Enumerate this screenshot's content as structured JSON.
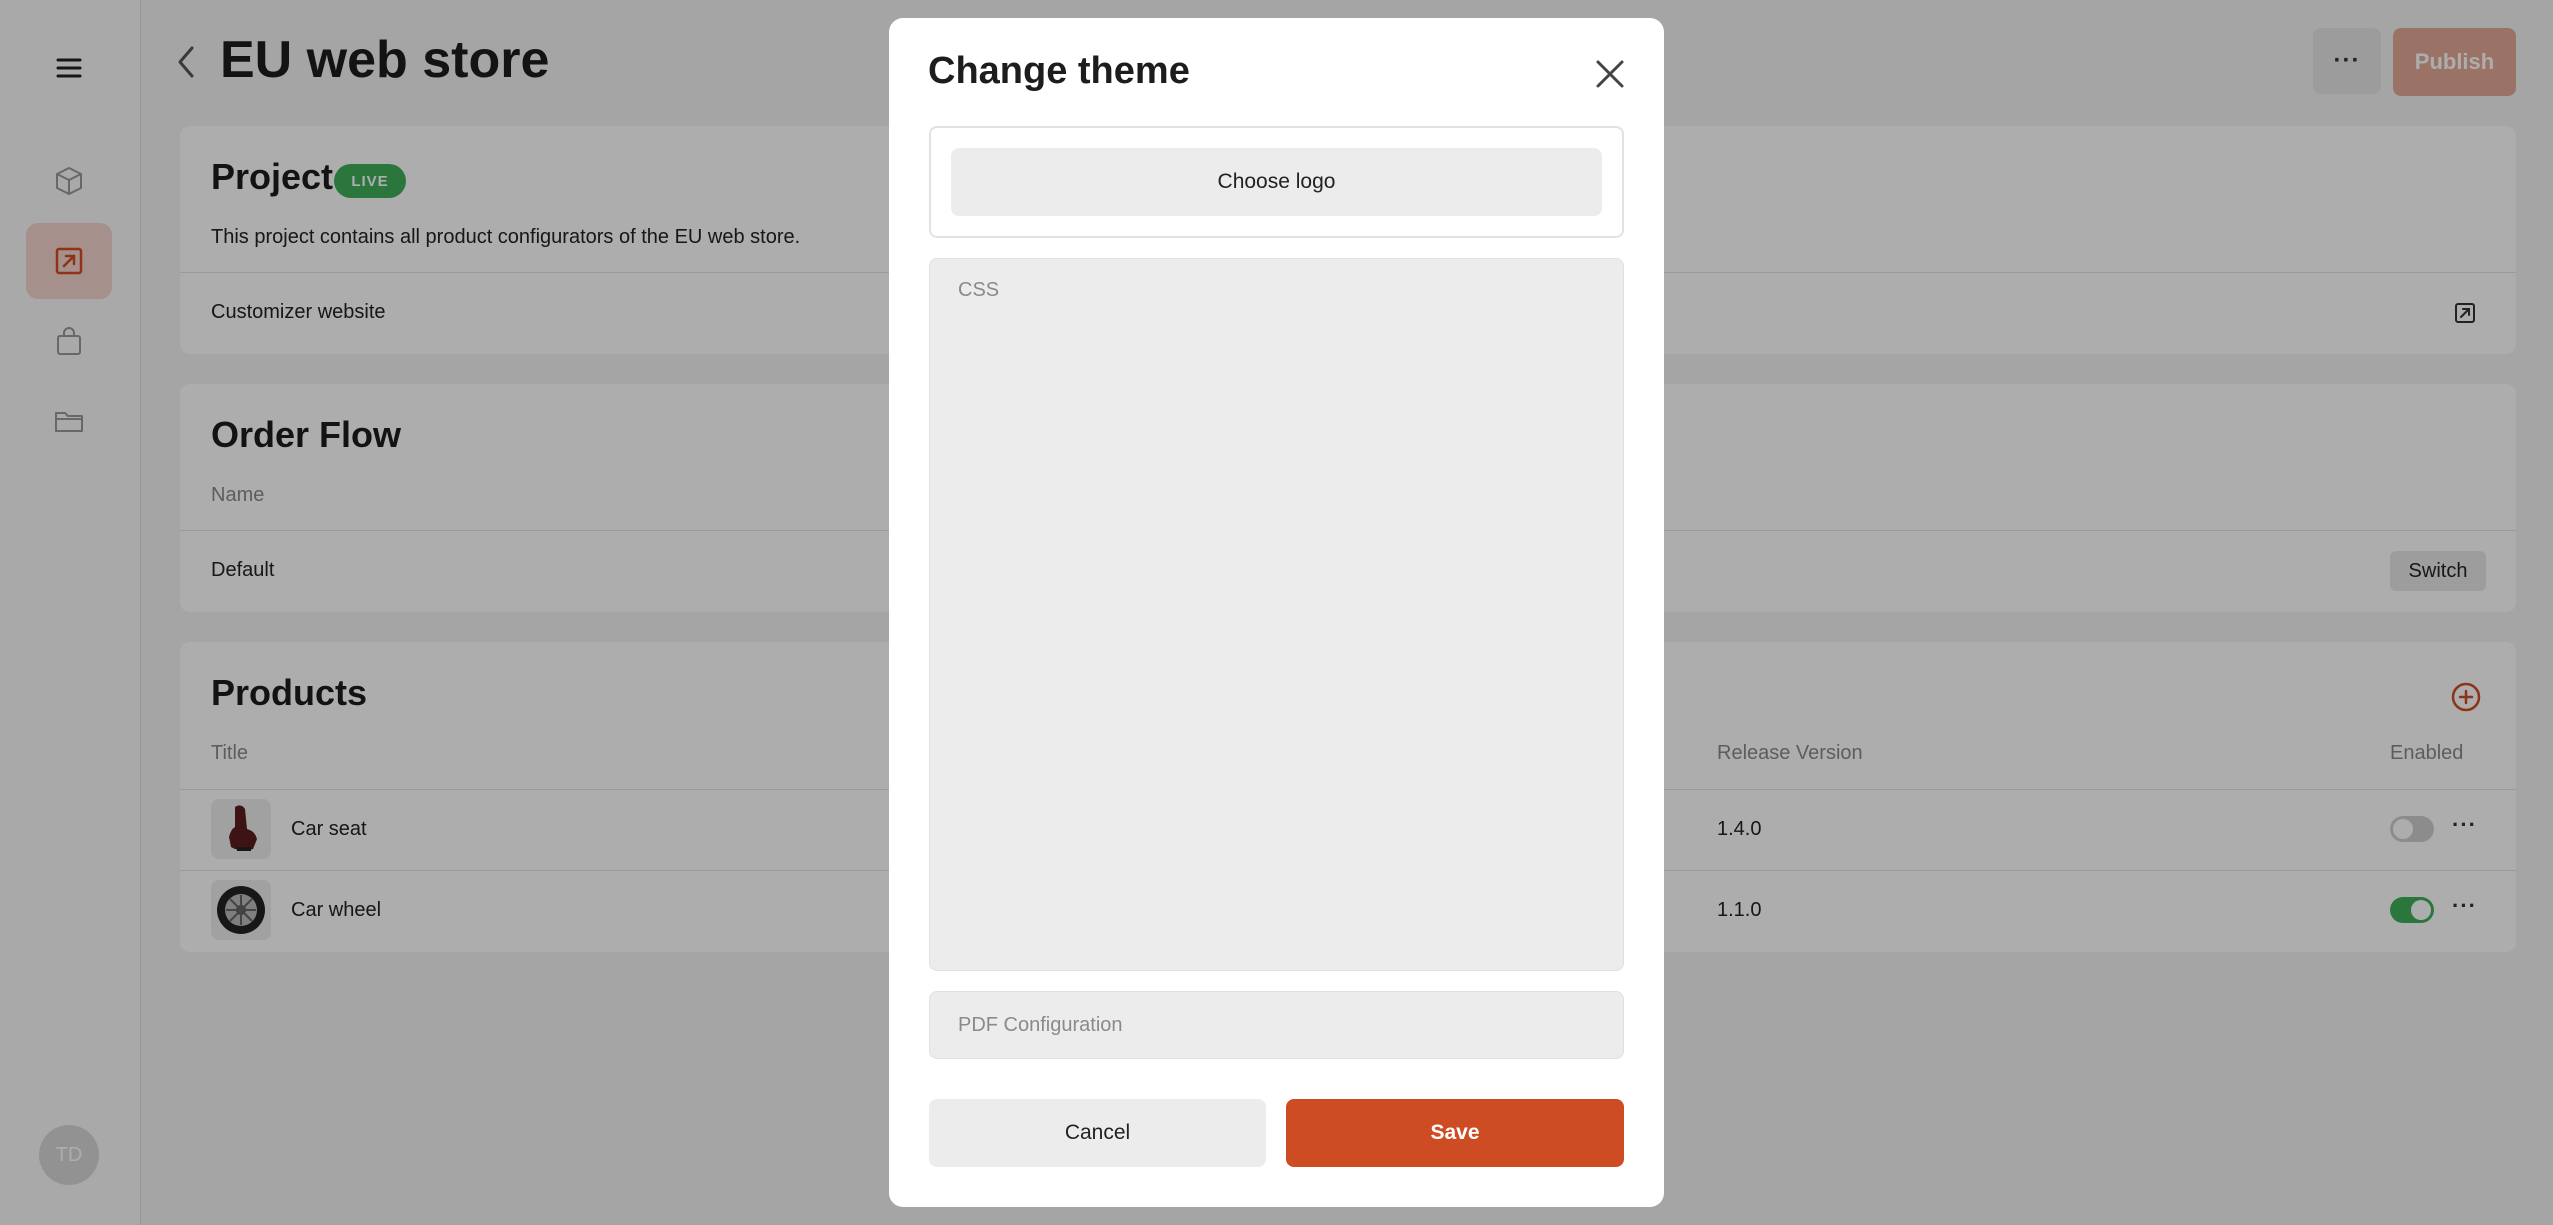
{
  "sidebar": {
    "avatar_initials": "TD",
    "items": [
      {
        "icon": "cube-icon"
      },
      {
        "icon": "external-link-icon",
        "active": true
      },
      {
        "icon": "bag-icon"
      },
      {
        "icon": "folder-icon"
      }
    ]
  },
  "header": {
    "title": "EU web store",
    "more_label": "···",
    "publish_label": "Publish"
  },
  "project": {
    "title": "Project",
    "badge": "LIVE",
    "description": "This project contains all product configurators of the EU web store.",
    "link_label": "Customizer website"
  },
  "order_flow": {
    "title": "Order Flow",
    "column_name": "Name",
    "row_name": "Default",
    "switch_label": "Switch"
  },
  "products": {
    "title": "Products",
    "columns": {
      "title": "Title",
      "release": "Release Version",
      "enabled": "Enabled"
    },
    "rows": [
      {
        "name": "Car seat",
        "version": "1.4.0",
        "enabled": false,
        "more": "···"
      },
      {
        "name": "Car wheel",
        "version": "1.1.0",
        "enabled": true,
        "more": "···"
      }
    ]
  },
  "modal": {
    "title": "Change theme",
    "choose_logo_label": "Choose logo",
    "css_placeholder": "CSS",
    "pdf_placeholder": "PDF Configuration",
    "cancel_label": "Cancel",
    "save_label": "Save"
  },
  "colors": {
    "accent": "#ce4c24",
    "live_green": "#3fae5b"
  }
}
